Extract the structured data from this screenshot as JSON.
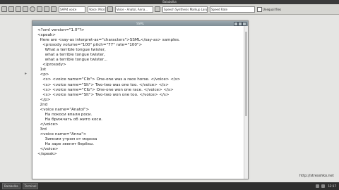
{
  "window": {
    "title": "Balabolka"
  },
  "toolbar": {
    "field_voice": "SAPI4 voice",
    "field_lang": "Voice: Microsoft Anna",
    "field_text": "Voice - Anatol, Anna...",
    "field_speaker": "Speech Synthesis Markup Language (SSML)",
    "field_speed": "Speed Rate",
    "check_label": "Unequal files"
  },
  "editor": {
    "title": "SSML",
    "lines": [
      "<?xml version=\"1.0\"?>",
      "<speak>",
      "  Here are <say-as interpret-as=\"characters\">SSML</say-as> samples.",
      "    <prosody volume=\"100\" pitch=\"77\" rate=\"100\">",
      "      What a terrible tongue twister,",
      "      what a terrible tongue twister,",
      "      what a terrible tongue twister...",
      "    </prosody>",
      "  1st",
      "  <p>",
      "    <s> <voice name=\"Clb\"> One-one was a race horse. </voice> </s>",
      "    <s> <voice name=\"Slt\"> Two-two was one too. </voice> </s>",
      "    <s> <voice name=\"Clb\"> One-one won one race. </voice> </s>",
      "    <s> <voice name=\"Slt\"> Two-two won one too. </voice> </s>",
      "  </p>",
      "  2nd",
      "  <voice name=\"Anatol\">",
      "      На покоси впали роси.",
      "      На брижчать об жито коси.",
      "  </voice>",
      "  3rd",
      "  <voice name=\"Anna\">",
      "      Зимним утром от мороза",
      "      На заре звенят берёзы.",
      "  </voice>",
      "</speak>"
    ]
  },
  "watermark": "http://stresshko.net",
  "taskbar": {
    "items": [
      "Balabolka",
      "Terminal"
    ],
    "clock": "12:17"
  }
}
